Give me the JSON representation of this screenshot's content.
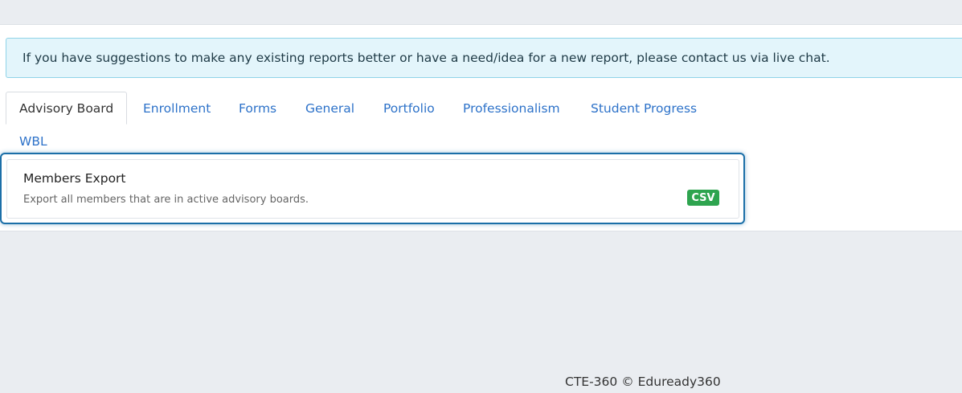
{
  "alert": {
    "message": "If you have suggestions to make any existing reports better or have a need/idea for a new report, please contact us via live chat."
  },
  "tabs": [
    {
      "label": "Advisory Board"
    },
    {
      "label": "Enrollment"
    },
    {
      "label": "Forms"
    },
    {
      "label": "General"
    },
    {
      "label": "Portfolio"
    },
    {
      "label": "Professionalism"
    },
    {
      "label": "Student Progress"
    },
    {
      "label": "WBL"
    }
  ],
  "reports": [
    {
      "title": "Members Export",
      "description": "Export all members that are in active advisory boards.",
      "format": "CSV"
    }
  ],
  "footer": {
    "text": "CTE-360 © Eduready360"
  },
  "colors": {
    "link": "#2d72c9",
    "alert_bg": "#e3f5fb",
    "alert_border": "#8fd3e8",
    "focus_border": "#1b6fa8",
    "csv_badge": "#2ea44f",
    "page_bg": "#eaedf1"
  }
}
